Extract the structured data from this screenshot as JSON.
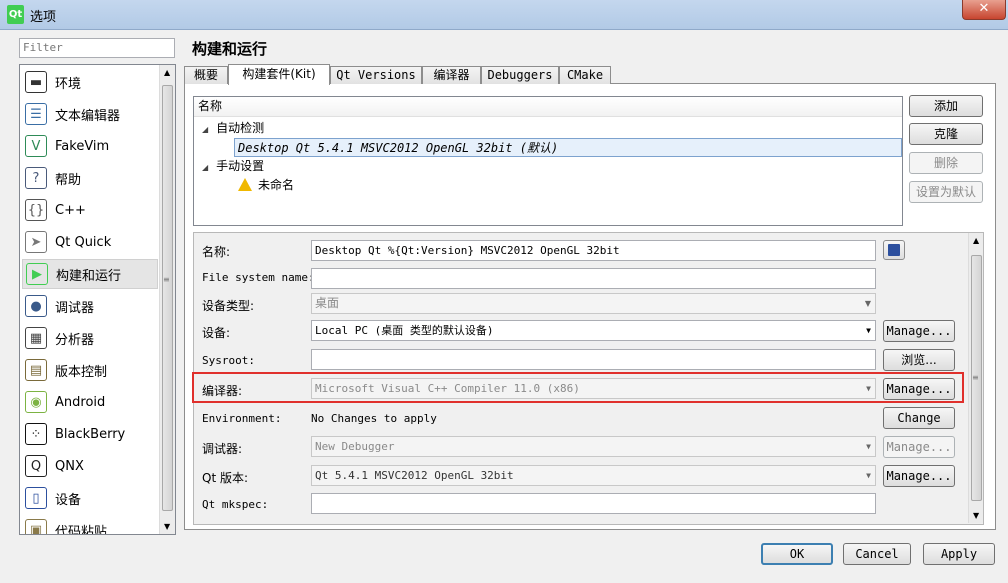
{
  "window": {
    "title": "选项",
    "app_icon": "Qt",
    "close_glyph": "✕"
  },
  "filter": {
    "placeholder": "Filter"
  },
  "categories": [
    {
      "label": "环境",
      "icon": "monitor-icon",
      "glyph": "▬",
      "color": "#333333"
    },
    {
      "label": "文本编辑器",
      "icon": "text-document-icon",
      "glyph": "☰",
      "color": "#3a6ea5"
    },
    {
      "label": "FakeVim",
      "icon": "fakevim-icon",
      "glyph": "V",
      "color": "#2e8b57"
    },
    {
      "label": "帮助",
      "icon": "help-icon",
      "glyph": "?",
      "color": "#4a5a7a"
    },
    {
      "label": "C++",
      "icon": "braces-icon",
      "glyph": "{}",
      "color": "#555555"
    },
    {
      "label": "Qt Quick",
      "icon": "paper-plane-icon",
      "glyph": "➤",
      "color": "#777777"
    },
    {
      "label": "构建和运行",
      "icon": "build-run-icon",
      "glyph": "▶",
      "color": "#41cd52"
    },
    {
      "label": "调试器",
      "icon": "bug-icon",
      "glyph": "●",
      "color": "#3a5a8a"
    },
    {
      "label": "分析器",
      "icon": "analyzer-icon",
      "glyph": "▦",
      "color": "#444444"
    },
    {
      "label": "版本控制",
      "icon": "version-control-icon",
      "glyph": "▤",
      "color": "#7a6a3a"
    },
    {
      "label": "Android",
      "icon": "android-icon",
      "glyph": "◉",
      "color": "#7cb342"
    },
    {
      "label": "BlackBerry",
      "icon": "blackberry-icon",
      "glyph": "⁘",
      "color": "#111111"
    },
    {
      "label": "QNX",
      "icon": "qnx-icon",
      "glyph": "Q",
      "color": "#222222"
    },
    {
      "label": "设备",
      "icon": "device-icon",
      "glyph": "▯",
      "color": "#2c4f9e"
    },
    {
      "label": "代码粘贴",
      "icon": "code-paste-icon",
      "glyph": "▣",
      "color": "#8a7a4a"
    }
  ],
  "page": {
    "title": "构建和运行"
  },
  "tabs": [
    "概要",
    "构建套件(Kit)",
    "Qt Versions",
    "编译器",
    "Debuggers",
    "CMake"
  ],
  "kit_tree": {
    "header": "名称",
    "auto_group": "自动检测",
    "auto_kit": "Desktop Qt 5.4.1 MSVC2012 OpenGL 32bit (默认)",
    "manual_group": "手动设置",
    "manual_kit": "未命名"
  },
  "kit_buttons": {
    "add": "添加",
    "clone": "克隆",
    "remove": "删除",
    "set_default": "设置为默认"
  },
  "form": {
    "name_label": "名称:",
    "name_value": "Desktop Qt %{Qt:Version} MSVC2012 OpenGL 32bit",
    "fs_label": "File system name:",
    "fs_value": "",
    "device_type_label": "设备类型:",
    "device_type_value": "桌面",
    "device_label": "设备:",
    "device_value": "Local PC (桌面 类型的默认设备)",
    "sysroot_label": "Sysroot:",
    "sysroot_value": "",
    "compiler_label": "编译器:",
    "compiler_value": "Microsoft Visual C++ Compiler 11.0 (x86)",
    "env_label": "Environment:",
    "env_value": "No Changes to apply",
    "debugger_label": "调试器:",
    "debugger_value": "New Debugger",
    "qt_version_label": "Qt 版本:",
    "qt_version_value": "Qt 5.4.1 MSVC2012 OpenGL 32bit",
    "mkspec_label": "Qt mkspec:",
    "mkspec_value": "",
    "manage": "Manage...",
    "browse": "浏览...",
    "change": "Change ..."
  },
  "dialog_buttons": {
    "ok": "OK",
    "cancel": "Cancel",
    "apply": "Apply"
  }
}
